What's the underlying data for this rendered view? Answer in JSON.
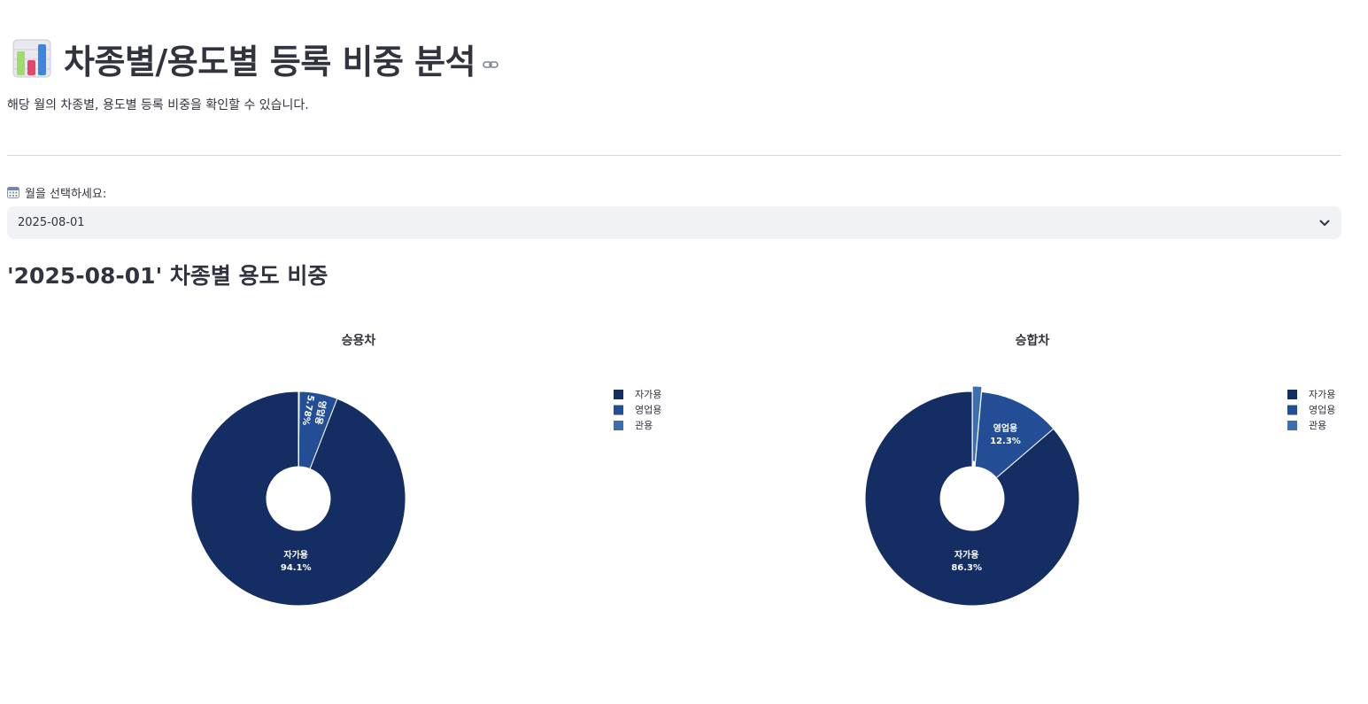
{
  "page": {
    "title": "차종별/용도별 등록 비중 분석",
    "title_icon": "bar-chart-icon",
    "subtitle": "해당 월의 차종별, 용도별 등록 비중을 확인할 수 있습니다."
  },
  "month_select": {
    "label": "월을 선택하세요:",
    "label_icon": "calendar-icon",
    "value": "2025-08-01"
  },
  "section": {
    "title": "'2025-08-01' 차종별 용도 비중"
  },
  "colors": {
    "private": "#142d63",
    "commercial": "#234e96",
    "government": "#3a6fb4"
  },
  "chart_data": [
    {
      "type": "pie",
      "title": "승용차",
      "hole": true,
      "labels": [
        "자가용",
        "영업용",
        "관용"
      ],
      "values": [
        94.1,
        5.78,
        0.12
      ],
      "value_labels": [
        "94.1%",
        "5.78%",
        ""
      ],
      "legend_position": "right"
    },
    {
      "type": "pie",
      "title": "승합차",
      "hole": true,
      "labels": [
        "자가용",
        "영업용",
        "관용"
      ],
      "values": [
        86.3,
        12.3,
        1.4
      ],
      "value_labels": [
        "86.3%",
        "12.3%",
        ""
      ],
      "legend_position": "right"
    }
  ]
}
